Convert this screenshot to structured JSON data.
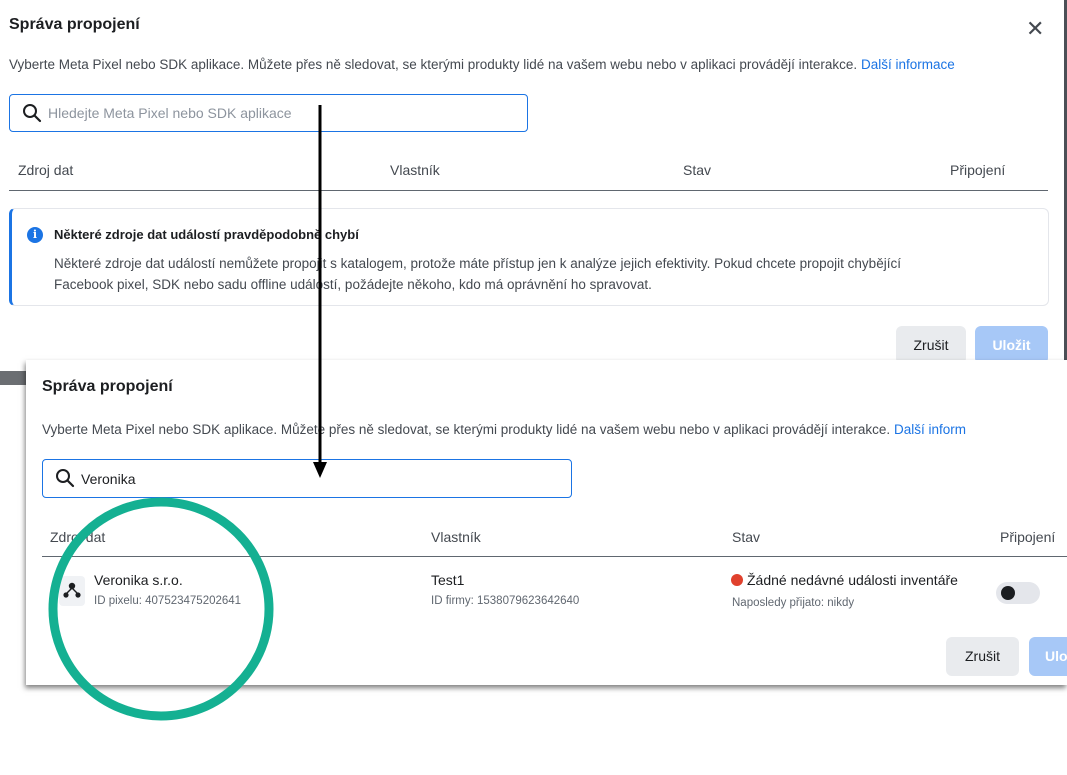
{
  "colors": {
    "accent": "#1b74e4",
    "annotation": "#14b092",
    "status_red": "#e0412d",
    "save_disabled": "#a7c8f7"
  },
  "dialog_top": {
    "title": "Správa propojení",
    "description": "Vyberte Meta Pixel nebo SDK aplikace. Můžete přes ně sledovat, se kterými produkty lidé na vašem webu nebo v aplikaci provádějí interakce.",
    "learn_more": "Další informace",
    "close_icon": "close-icon",
    "search": {
      "placeholder": "Hledejte Meta Pixel nebo SDK aplikace",
      "value": ""
    },
    "columns": {
      "source": "Zdroj dat",
      "owner": "Vlastník",
      "status": "Stav",
      "connection": "Připojení"
    },
    "banner": {
      "title": "Některé zdroje dat událostí pravděpodobně chybí",
      "line1": "Některé zdroje dat událostí nemůžete propojit s katalogem, protože máte přístup jen k analýze jejich efektivity. Pokud chcete propojit chybějící",
      "line2": "Facebook pixel, SDK nebo sadu offline událostí, požádejte někoho, kdo má oprávnění ho spravovat."
    },
    "cancel_label": "Zrušit",
    "save_label": "Uložit"
  },
  "dialog_bottom": {
    "title": "Správa propojení",
    "description": "Vyberte Meta Pixel nebo SDK aplikace. Můžete přes ně sledovat, se kterými produkty lidé na vašem webu nebo v aplikaci provádějí interakce.",
    "learn_more": "Další inform",
    "search": {
      "placeholder": "Hledejte Meta Pixel nebo SDK aplikace",
      "value": "Veronika"
    },
    "columns": {
      "source": "Zdroj dat",
      "owner": "Vlastník",
      "status": "Stav",
      "connection": "Připojení"
    },
    "row": {
      "name": "Veronika s.r.o.",
      "pixel_id": "ID pixelu: 407523475202641",
      "owner": "Test1",
      "business_id": "ID firmy: 1538079623642640",
      "status": "Žádné nedávné události inventáře",
      "last_received": "Naposledy přijato: nikdy",
      "connected": false
    },
    "cancel_label": "Zrušit",
    "save_label": "Ulo"
  }
}
